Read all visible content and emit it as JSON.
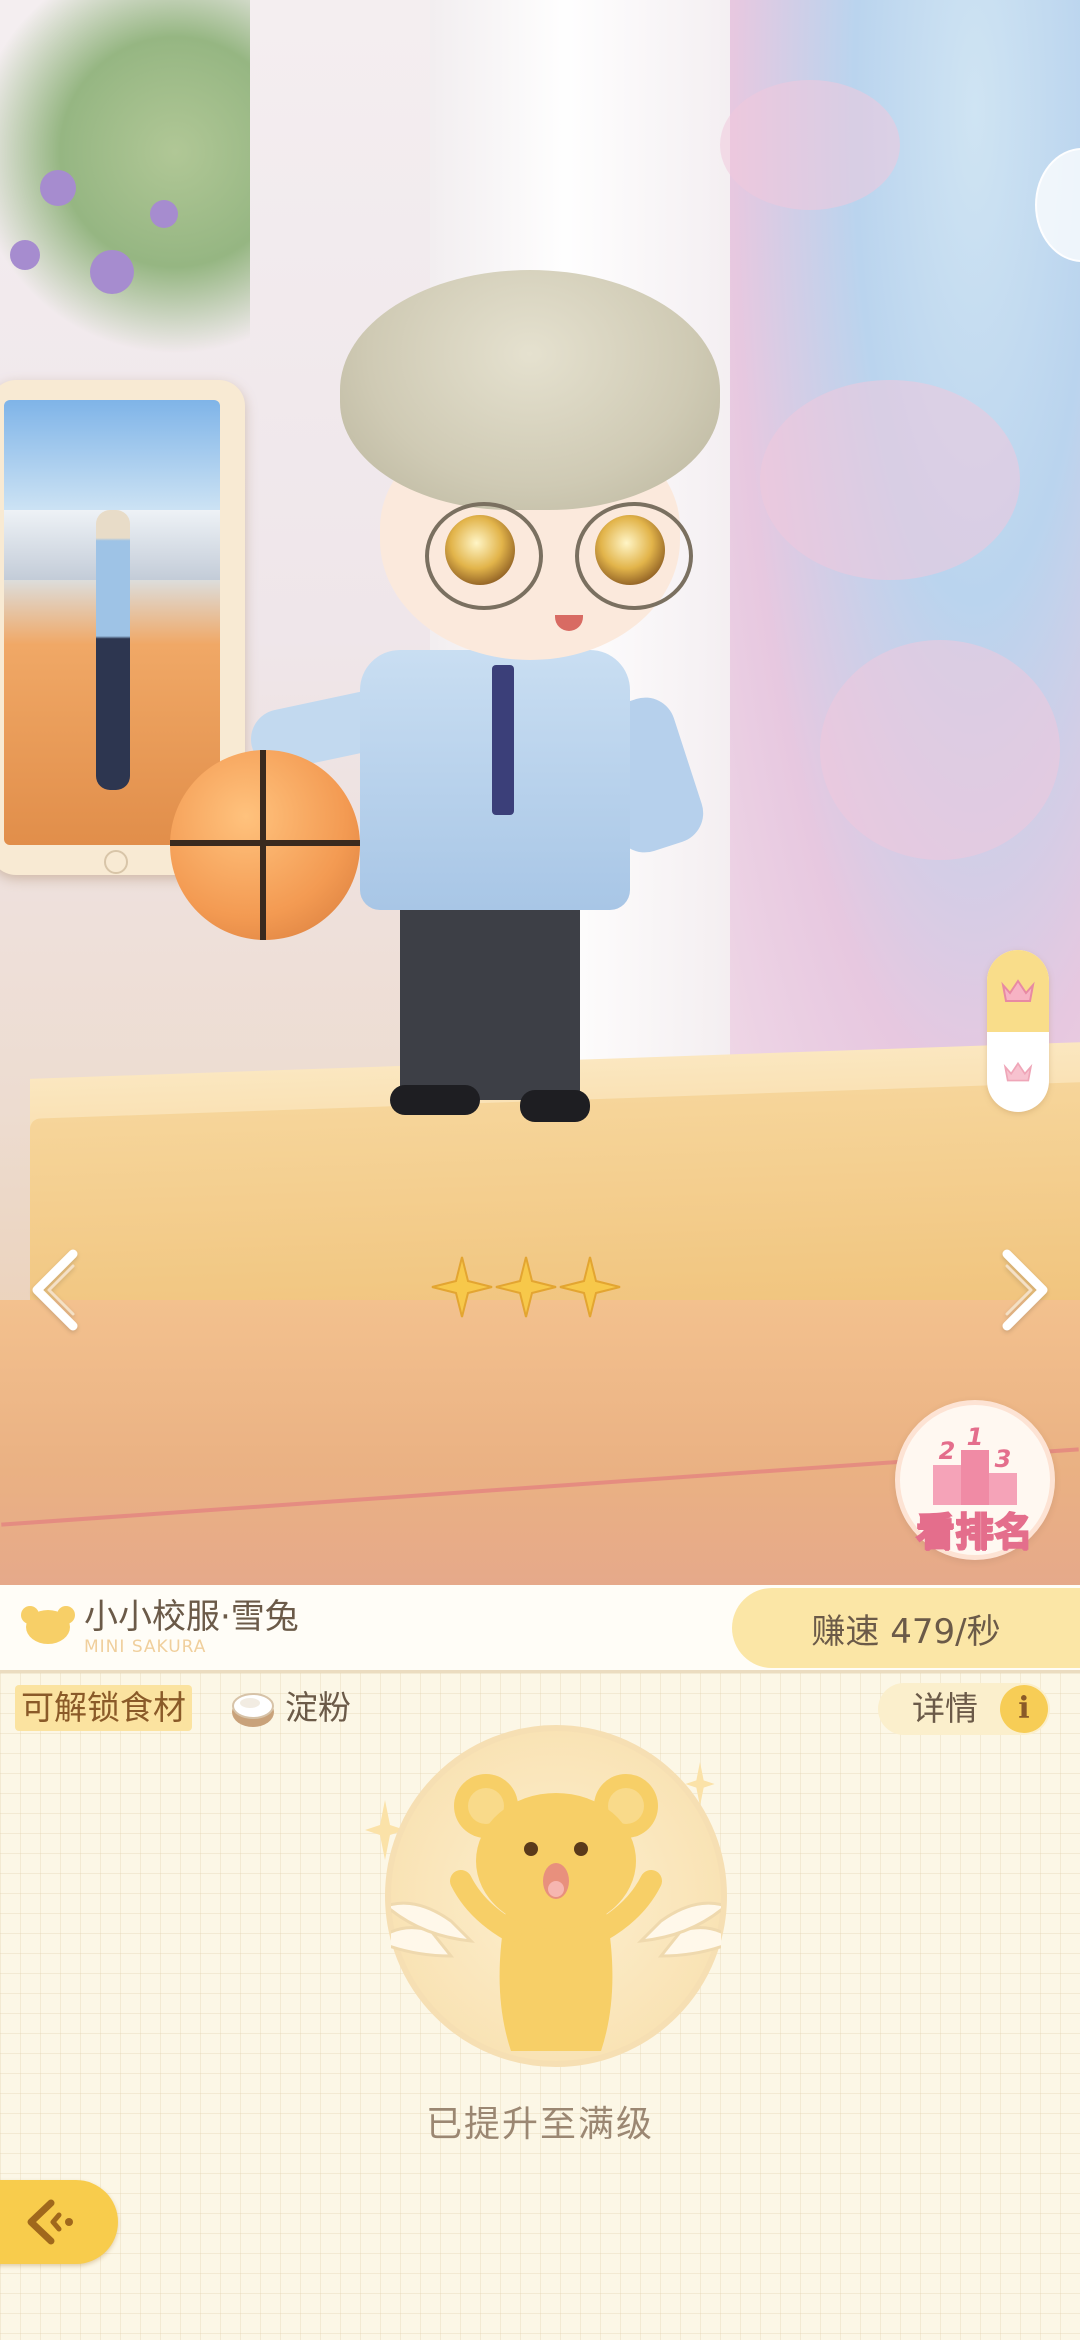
{
  "scene": {
    "nav": {
      "prev_icon": "chevron-left-icon",
      "next_icon": "chevron-right-icon"
    },
    "stars": {
      "filled": 3,
      "max": 3,
      "icon": "star-sparkle-icon",
      "color": "#f7c84a"
    },
    "crown_toggle": {
      "top_icon": "crown-icon",
      "bottom_icon": "crown-icon",
      "active": "top"
    },
    "ranking_button": {
      "label": "看排名",
      "podium": [
        "2",
        "1",
        "3"
      ]
    }
  },
  "card": {
    "title": "小小校服·雪兔",
    "subtitle": "MINI SAKURA",
    "earn_rate": "赚速 479/秒"
  },
  "panel": {
    "unlock_label": "可解锁食材",
    "ingredient_name": "淀粉",
    "details_label": "详情",
    "info_icon_text": "i",
    "max_level_text": "已提升至满级"
  },
  "colors": {
    "accent_yellow": "#f8cc4c",
    "panel_bg": "#fcf7e6",
    "text_brown": "#6b5a48",
    "rank_pink": "#e46e8c"
  }
}
